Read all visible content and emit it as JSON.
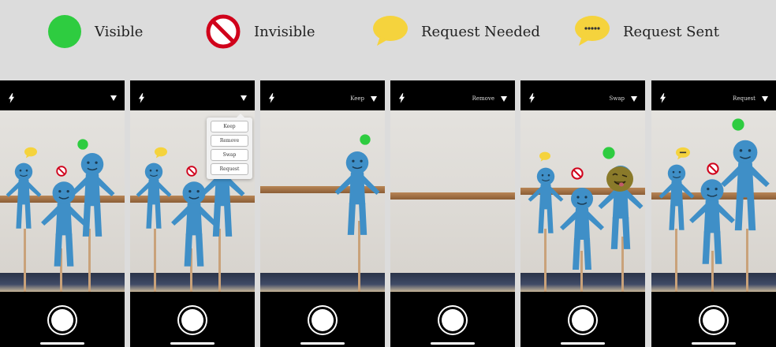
{
  "legend": {
    "items": [
      {
        "icon": "green-circle-icon",
        "label": "Visible",
        "color": "#2ecc40"
      },
      {
        "icon": "prohibited-icon",
        "label": "Invisible",
        "color": "#d0021b"
      },
      {
        "icon": "speech-bubble-icon",
        "label": "Request Needed",
        "color": "#f5d33d"
      },
      {
        "icon": "speech-bubble-dots-icon",
        "label": "Request Sent",
        "color": "#f5d33d"
      }
    ]
  },
  "screens": [
    {
      "mode": ""
    },
    {
      "mode": "",
      "menu": [
        "Keep",
        "Remove",
        "Swap",
        "Request"
      ]
    },
    {
      "mode": "Keep"
    },
    {
      "mode": "Remove"
    },
    {
      "mode": "Swap"
    },
    {
      "mode": "Request"
    }
  ],
  "colors": {
    "figure": "#3f8fc7",
    "figure_dark": "#2d6e9e",
    "visible": "#2ecc40",
    "invisible": "#d0021b",
    "request": "#f5d33d",
    "swap_face": "#8a7a2a"
  }
}
